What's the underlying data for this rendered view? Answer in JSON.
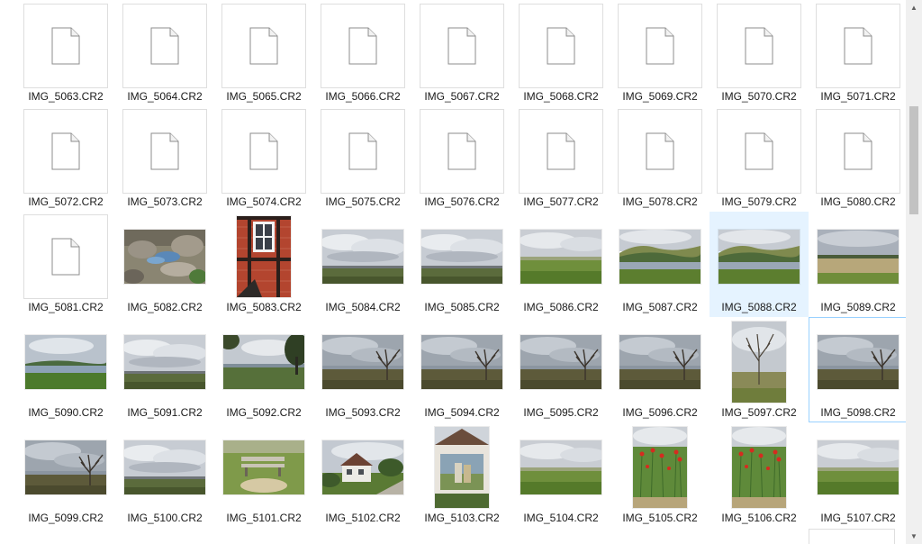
{
  "items": [
    {
      "label": "IMG_5063.CR2",
      "kind": "blank"
    },
    {
      "label": "IMG_5064.CR2",
      "kind": "blank"
    },
    {
      "label": "IMG_5065.CR2",
      "kind": "blank"
    },
    {
      "label": "IMG_5066.CR2",
      "kind": "blank"
    },
    {
      "label": "IMG_5067.CR2",
      "kind": "blank"
    },
    {
      "label": "IMG_5068.CR2",
      "kind": "blank"
    },
    {
      "label": "IMG_5069.CR2",
      "kind": "blank"
    },
    {
      "label": "IMG_5070.CR2",
      "kind": "blank"
    },
    {
      "label": "IMG_5071.CR2",
      "kind": "blank"
    },
    {
      "label": "IMG_5072.CR2",
      "kind": "blank"
    },
    {
      "label": "IMG_5073.CR2",
      "kind": "blank"
    },
    {
      "label": "IMG_5074.CR2",
      "kind": "blank"
    },
    {
      "label": "IMG_5075.CR2",
      "kind": "blank"
    },
    {
      "label": "IMG_5076.CR2",
      "kind": "blank"
    },
    {
      "label": "IMG_5077.CR2",
      "kind": "blank"
    },
    {
      "label": "IMG_5078.CR2",
      "kind": "blank"
    },
    {
      "label": "IMG_5079.CR2",
      "kind": "blank"
    },
    {
      "label": "IMG_5080.CR2",
      "kind": "blank"
    },
    {
      "label": "IMG_5081.CR2",
      "kind": "blank"
    },
    {
      "label": "IMG_5082.CR2",
      "kind": "photo",
      "scene": "rocks"
    },
    {
      "label": "IMG_5083.CR2",
      "kind": "photo",
      "scene": "window",
      "portrait": true
    },
    {
      "label": "IMG_5084.CR2",
      "kind": "photo",
      "scene": "sky-field"
    },
    {
      "label": "IMG_5085.CR2",
      "kind": "photo",
      "scene": "sky-field"
    },
    {
      "label": "IMG_5086.CR2",
      "kind": "photo",
      "scene": "green-field"
    },
    {
      "label": "IMG_5087.CR2",
      "kind": "photo",
      "scene": "hills-water"
    },
    {
      "label": "IMG_5088.CR2",
      "kind": "photo",
      "scene": "hills-water",
      "state": "hover"
    },
    {
      "label": "IMG_5089.CR2",
      "kind": "photo",
      "scene": "reeds"
    },
    {
      "label": "IMG_5090.CR2",
      "kind": "photo",
      "scene": "lake"
    },
    {
      "label": "IMG_5091.CR2",
      "kind": "photo",
      "scene": "sky-field"
    },
    {
      "label": "IMG_5092.CR2",
      "kind": "photo",
      "scene": "trees"
    },
    {
      "label": "IMG_5093.CR2",
      "kind": "photo",
      "scene": "dead-tree"
    },
    {
      "label": "IMG_5094.CR2",
      "kind": "photo",
      "scene": "dead-tree"
    },
    {
      "label": "IMG_5095.CR2",
      "kind": "photo",
      "scene": "dead-tree"
    },
    {
      "label": "IMG_5096.CR2",
      "kind": "photo",
      "scene": "dead-tree"
    },
    {
      "label": "IMG_5097.CR2",
      "kind": "photo",
      "scene": "tall-tree",
      "portrait": true
    },
    {
      "label": "IMG_5098.CR2",
      "kind": "photo",
      "scene": "dead-tree",
      "state": "selected"
    },
    {
      "label": "IMG_5099.CR2",
      "kind": "photo",
      "scene": "dead-tree"
    },
    {
      "label": "IMG_5100.CR2",
      "kind": "photo",
      "scene": "sky-field"
    },
    {
      "label": "IMG_5101.CR2",
      "kind": "photo",
      "scene": "bench"
    },
    {
      "label": "IMG_5102.CR2",
      "kind": "photo",
      "scene": "house"
    },
    {
      "label": "IMG_5103.CR2",
      "kind": "photo",
      "scene": "mural",
      "portrait": true
    },
    {
      "label": "IMG_5104.CR2",
      "kind": "photo",
      "scene": "green-field"
    },
    {
      "label": "IMG_5105.CR2",
      "kind": "photo",
      "scene": "poppies",
      "portrait": true
    },
    {
      "label": "IMG_5106.CR2",
      "kind": "photo",
      "scene": "poppies",
      "portrait": true
    },
    {
      "label": "IMG_5107.CR2",
      "kind": "photo",
      "scene": "green-field"
    }
  ],
  "colors": {
    "hover_bg": "#e5f3ff",
    "selected_border": "#99d1ff",
    "label_text": "#1a1a1a",
    "scrollbar_track": "#f0f0f0",
    "scrollbar_thumb": "#c2c2c2"
  },
  "icons": {
    "blank_file": "document-icon",
    "scroll_up": "arrow-up-icon",
    "scroll_down": "arrow-down-icon"
  }
}
